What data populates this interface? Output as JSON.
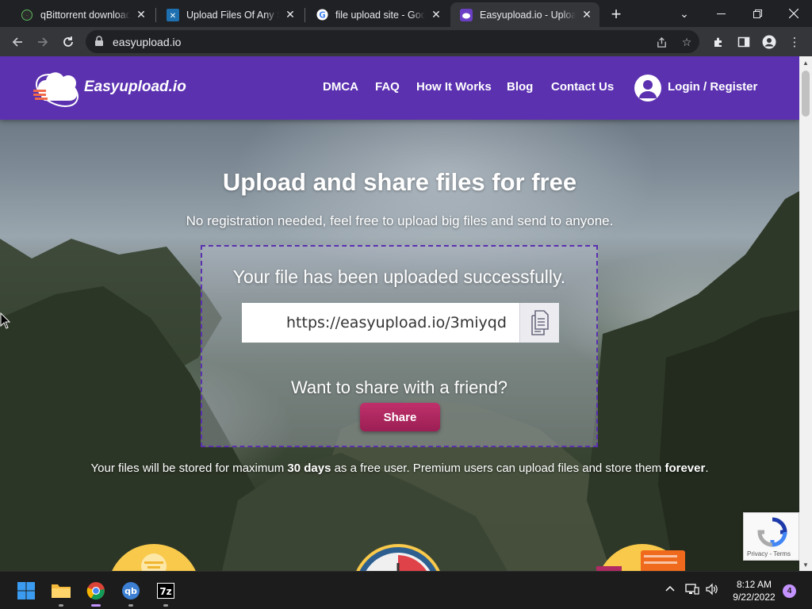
{
  "browser": {
    "tabs": [
      {
        "title": "qBittorrent download l",
        "icon": "qbittorrent-icon",
        "active": false
      },
      {
        "title": "Upload Files Of Any Siz",
        "icon": "upload-site-icon",
        "active": false
      },
      {
        "title": "file upload site - Googl",
        "icon": "google-icon",
        "active": false
      },
      {
        "title": "Easyupload.io - Upload",
        "icon": "easyupload-icon",
        "active": true
      }
    ],
    "address": "easyupload.io"
  },
  "site": {
    "brand": "Easyupload.io",
    "nav": [
      "DMCA",
      "FAQ",
      "How It Works",
      "Blog",
      "Contact Us"
    ],
    "login": "Login / Register",
    "colors": {
      "header": "#5b31b0",
      "share_button": "#b02a63"
    }
  },
  "hero": {
    "title": "Upload and share files for free",
    "subtitle": "No registration needed, feel free to upload big files and send to anyone."
  },
  "upload": {
    "success_message": "Your file has been uploaded successfully.",
    "link": "https://easyupload.io/3miyqd",
    "share_question": "Want to share with a friend?",
    "share_button": "Share"
  },
  "storage_note": {
    "part1": "Your files will be stored for maximum ",
    "days": "30 days",
    "part2": " as a free user. Premium users can upload files and store them ",
    "forever": "forever",
    "part3": "."
  },
  "recaptcha": {
    "links": "Privacy - Terms"
  },
  "taskbar": {
    "apps": [
      "start-icon",
      "file-explorer-icon",
      "chrome-icon",
      "qbittorrent-icon",
      "7zip-icon"
    ],
    "time": "8:12 AM",
    "date": "9/22/2022",
    "notifications": "4"
  }
}
